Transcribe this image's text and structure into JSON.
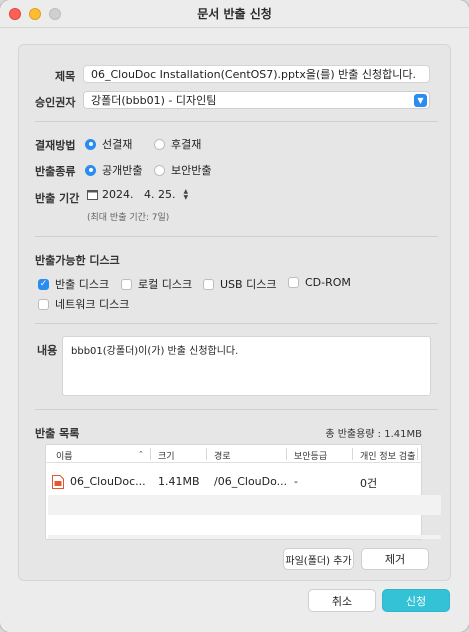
{
  "window": {
    "title": "문서 반출 신청"
  },
  "form": {
    "title_label": "제목",
    "title_value": "06_ClouDoc Installation(CentOS7).pptx을(를) 반출 신청합니다.",
    "approver_label": "승인권자",
    "approver_value": "강폴더(bbb01) - 디자인팀",
    "payment_label": "결재방법",
    "payment_options": [
      "선결재",
      "후결재"
    ],
    "payment_selected": "선결재",
    "export_type_label": "반출종류",
    "export_type_options": [
      "공개반출",
      "보안반출"
    ],
    "export_type_selected": "공개반출",
    "period_label": "반출 기간",
    "period_value": "2024.   4. 25.",
    "period_hint": "(최대 반출 기간: 7일)",
    "disk_section_label": "반출가능한 디스크",
    "disks": [
      {
        "label": "반출 디스크",
        "checked": true
      },
      {
        "label": "로컬 디스크",
        "checked": false
      },
      {
        "label": "USB 디스크",
        "checked": false
      },
      {
        "label": "CD-ROM",
        "checked": false
      },
      {
        "label": "네트워크 디스크",
        "checked": false
      }
    ],
    "content_label": "내용",
    "content_value": "bbb01(강폴더)이(가) 반출 신청합니다."
  },
  "export_list": {
    "label": "반출 목록",
    "total": "총 반출용량 : 1.41MB",
    "columns": [
      "이름",
      "크기",
      "경로",
      "보안등급",
      "개인 정보 검출"
    ],
    "rows": [
      {
        "name": "06_ClouDoc...",
        "size": "1.41MB",
        "path": "/06_ClouDo...",
        "level": "-",
        "pii": "0건",
        "icon": "pptx-file-icon"
      }
    ]
  },
  "buttons": {
    "add": "파일(폴더) 추가",
    "remove": "제거",
    "cancel": "취소",
    "submit": "신청"
  },
  "colors": {
    "accent": "#2a8cf0",
    "primary_button": "#33c2d6"
  }
}
